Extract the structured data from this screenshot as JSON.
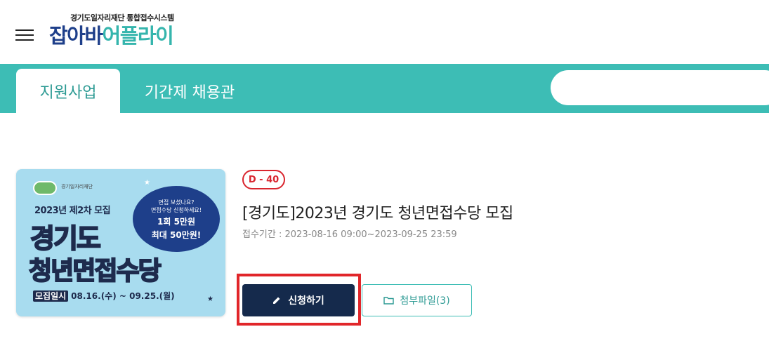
{
  "header": {
    "logo_subtitle": "경기도일자리재단 통합접수시스템",
    "logo_part1": "잡아바",
    "logo_part2": "어플라이",
    "menu_icon": "hamburger-menu-icon"
  },
  "tabs": [
    {
      "label": "지원사업",
      "active": true
    },
    {
      "label": "기간제 채용관",
      "active": false
    }
  ],
  "search": {
    "placeholder": ""
  },
  "listing": {
    "dday": "D - 40",
    "title": "[경기도]2023년 경기도 청년면접수당 모집",
    "period_label": "접수기간 :",
    "period_value": "2023-08-16 09:00~2023-09-25 23:59",
    "apply_button": "신청하기",
    "apply_icon": "pencil-icon",
    "attach_button": "첨부파일(3)",
    "attach_icon": "folder-icon",
    "thumbnail": {
      "round": "2023년 제2차 모집",
      "headline1": "경기도",
      "headline2": "청년면접수당",
      "bubble_line1": "면접 보셨나요?",
      "bubble_line2": "면접수당 신청하세요!",
      "bubble_line3": "1회 5만원",
      "bubble_line4": "최대 50만원!",
      "period_tag": "모집일시",
      "period_text": "08.16.(수) ~ 09.25.(월)"
    }
  },
  "colors": {
    "teal": "#3dbdb5",
    "navy": "#152a4c",
    "red": "#d9252e",
    "highlight": "#e1262a"
  }
}
